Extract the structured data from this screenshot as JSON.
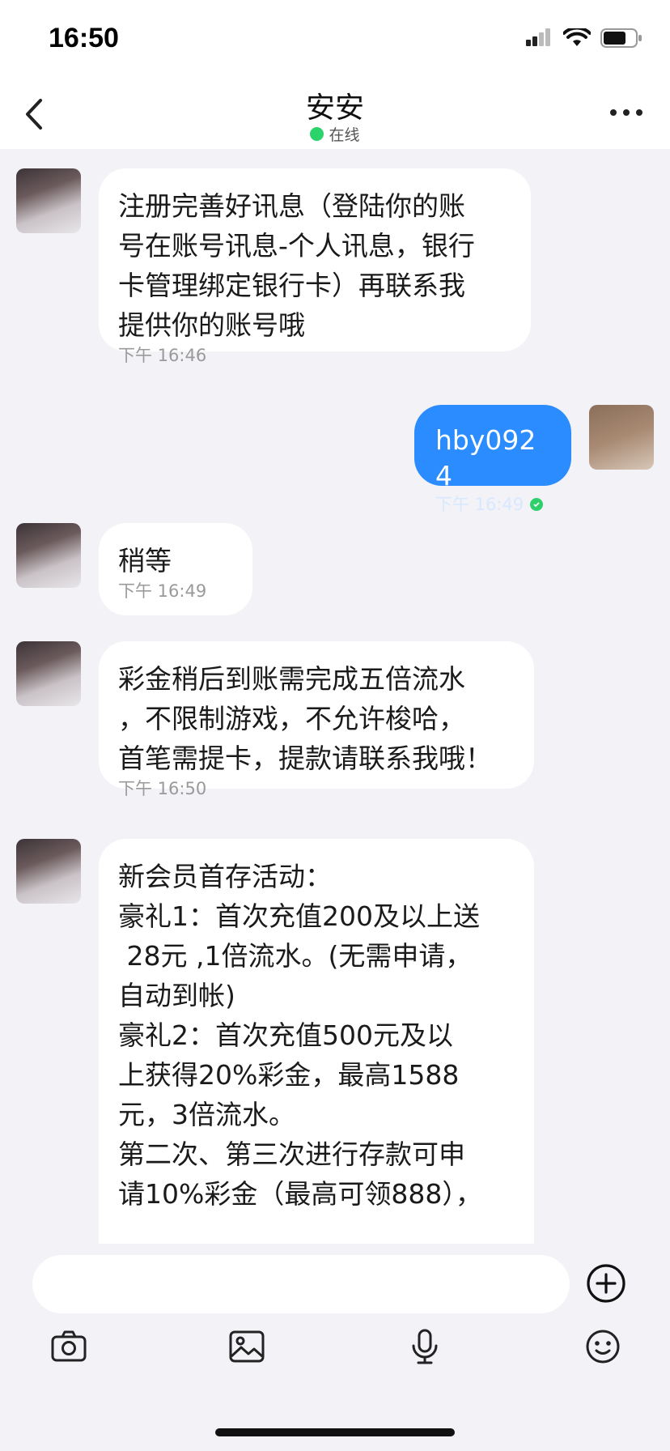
{
  "status_bar": {
    "time": "16:50"
  },
  "header": {
    "title": "安安",
    "status": "在线"
  },
  "messages": [
    {
      "from": "contact",
      "text": "注册完善好讯息（登陆你的账\n号在账号讯息-个人讯息，银行\n卡管理绑定银行卡）再联系我\n提供你的账号哦",
      "time": "下午 16:46"
    },
    {
      "from": "me",
      "text": "hby0924",
      "time": "下午 16:49",
      "read": true
    },
    {
      "from": "contact",
      "text": "稍等",
      "time": "下午 16:49"
    },
    {
      "from": "contact",
      "text": "彩金稍后到账需完成五倍流水\n，不限制游戏，不允许梭哈，\n首笔需提卡，提款请联系我哦！",
      "time": "下午 16:50"
    },
    {
      "from": "contact",
      "text": "新会员首存活动：\n豪礼1：首次充值200及以上送\n 28元 ,1倍流水。(无需申请，\n自动到帐)\n豪礼2：首次充值500元及以\n上获得20%彩金，最高1588\n元，3倍流水。\n第二次、第三次进行存款可申\n请10%彩金（最高可领888），",
      "time": ""
    }
  ],
  "composer": {
    "placeholder": ""
  },
  "icons": {
    "back": "chevron-left-icon",
    "more": "more-icon",
    "plus": "plus-circle-icon",
    "camera": "camera-icon",
    "image": "image-icon",
    "mic": "microphone-icon",
    "emoji": "emoji-icon"
  },
  "colors": {
    "accent": "#2b8cff",
    "online": "#2bd36a",
    "background": "#f2f2f7"
  }
}
